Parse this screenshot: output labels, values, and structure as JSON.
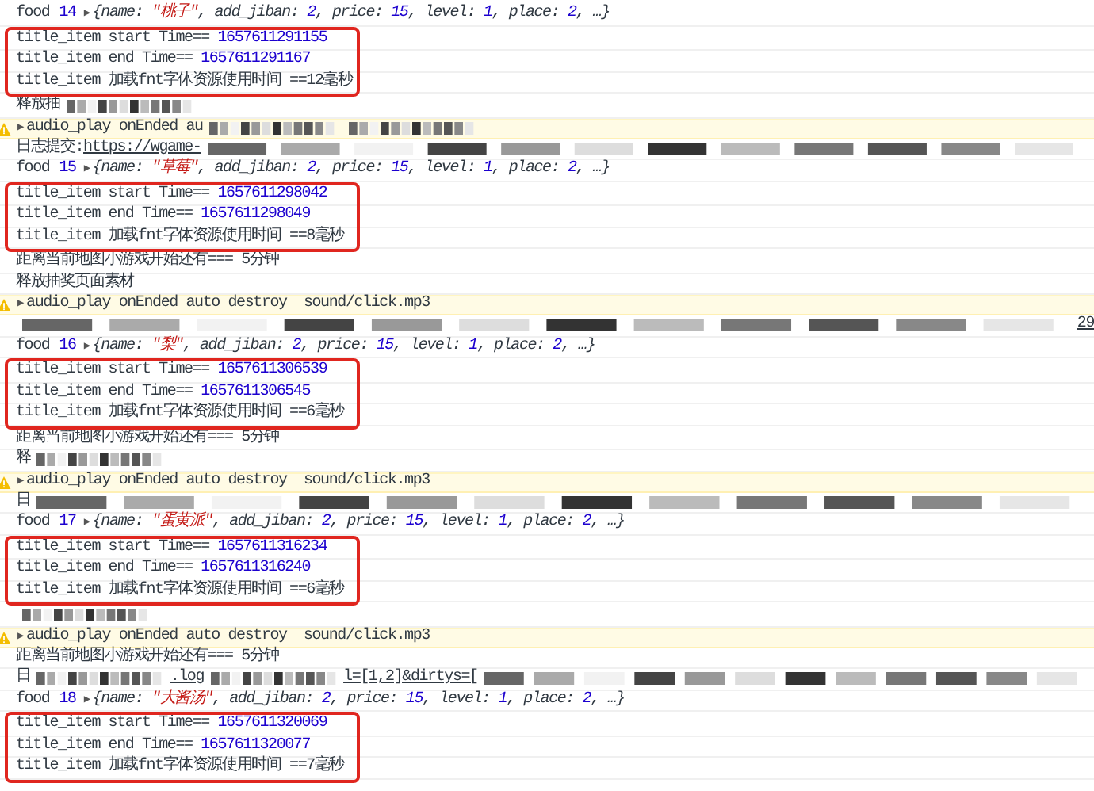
{
  "entries": [
    {
      "kind": "food",
      "label": "food",
      "index": "14",
      "toggle": "▶",
      "segments": [
        {
          "t": "{name: ",
          "kind": "plain"
        },
        {
          "t": "\"桃子\"",
          "kind": "string"
        },
        {
          "t": ", add_jiban: ",
          "kind": "plain"
        },
        {
          "t": "2",
          "kind": "number"
        },
        {
          "t": ", price: ",
          "kind": "plain"
        },
        {
          "t": "15",
          "kind": "number"
        },
        {
          "t": ", level: ",
          "kind": "plain"
        },
        {
          "t": "1",
          "kind": "number"
        },
        {
          "t": ", place: ",
          "kind": "plain"
        },
        {
          "t": "2",
          "kind": "number"
        },
        {
          "t": ", …}",
          "kind": "plain"
        }
      ]
    },
    {
      "kind": "timing",
      "highlighted": true,
      "lines": [
        [
          {
            "t": "title_item start Time== ",
            "kind": "plain"
          },
          {
            "t": "1657611291155",
            "kind": "number"
          }
        ],
        [
          {
            "t": "title_item end Time== ",
            "kind": "plain"
          },
          {
            "t": "1657611291167",
            "kind": "number"
          }
        ],
        [
          {
            "t": "title_item 加载fnt字体资源使用时间 ==12毫秒",
            "kind": "plain"
          }
        ]
      ]
    },
    {
      "kind": "log",
      "segments": [
        {
          "t": "释放抽",
          "kind": "plain"
        },
        {
          "kind": "redacted"
        }
      ]
    },
    {
      "kind": "warn",
      "toggle": "▶",
      "segments": [
        {
          "t": "audio_play onEnded au",
          "kind": "plain"
        },
        {
          "kind": "redacted"
        },
        {
          "kind": "redacted"
        }
      ]
    },
    {
      "kind": "log",
      "segments": [
        {
          "t": "日志提交:",
          "kind": "plain"
        },
        {
          "t": "https://wgame-",
          "kind": "link"
        },
        {
          "kind": "redacted_fill"
        }
      ]
    },
    {
      "kind": "food",
      "label": "food",
      "index": "15",
      "toggle": "▶",
      "segments": [
        {
          "t": "{name: ",
          "kind": "plain"
        },
        {
          "t": "\"草莓\"",
          "kind": "string"
        },
        {
          "t": ", add_jiban: ",
          "kind": "plain"
        },
        {
          "t": "2",
          "kind": "number"
        },
        {
          "t": ", price: ",
          "kind": "plain"
        },
        {
          "t": "15",
          "kind": "number"
        },
        {
          "t": ", level: ",
          "kind": "plain"
        },
        {
          "t": "1",
          "kind": "number"
        },
        {
          "t": ", place: ",
          "kind": "plain"
        },
        {
          "t": "2",
          "kind": "number"
        },
        {
          "t": ", …}",
          "kind": "plain"
        }
      ]
    },
    {
      "kind": "timing",
      "highlighted": true,
      "lines": [
        [
          {
            "t": "title_item start Time== ",
            "kind": "plain"
          },
          {
            "t": "1657611298042",
            "kind": "number"
          }
        ],
        [
          {
            "t": "title_item end Time== ",
            "kind": "plain"
          },
          {
            "t": "1657611298049",
            "kind": "number"
          }
        ],
        [
          {
            "t": "title_item 加载fnt字体资源使用时间 ==8毫秒",
            "kind": "plain"
          }
        ]
      ]
    },
    {
      "kind": "log",
      "segments": [
        {
          "t": "距离当前地图小游戏开始还有=== 5分钟",
          "kind": "plain"
        }
      ]
    },
    {
      "kind": "log",
      "segments": [
        {
          "t": "释放抽奖页面素材",
          "kind": "plain"
        }
      ]
    },
    {
      "kind": "warn",
      "toggle": "▶",
      "segments": [
        {
          "t": "audio_play onEnded auto destroy  sound/click.mp3",
          "kind": "plain"
        }
      ]
    },
    {
      "kind": "log",
      "segments": [
        {
          "kind": "redacted_fill"
        },
        {
          "t": "29",
          "kind": "link"
        }
      ]
    },
    {
      "kind": "food",
      "label": "food",
      "index": "16",
      "toggle": "▶",
      "segments": [
        {
          "t": "{name: ",
          "kind": "plain"
        },
        {
          "t": "\"梨\"",
          "kind": "string"
        },
        {
          "t": ", add_jiban: ",
          "kind": "plain"
        },
        {
          "t": "2",
          "kind": "number"
        },
        {
          "t": ", price: ",
          "kind": "plain"
        },
        {
          "t": "15",
          "kind": "number"
        },
        {
          "t": ", level: ",
          "kind": "plain"
        },
        {
          "t": "1",
          "kind": "number"
        },
        {
          "t": ", place: ",
          "kind": "plain"
        },
        {
          "t": "2",
          "kind": "number"
        },
        {
          "t": ", …}",
          "kind": "plain"
        }
      ]
    },
    {
      "kind": "timing",
      "highlighted": true,
      "lines": [
        [
          {
            "t": "title_item start Time== ",
            "kind": "plain"
          },
          {
            "t": "1657611306539",
            "kind": "number"
          }
        ],
        [
          {
            "t": "title_item end Time== ",
            "kind": "plain"
          },
          {
            "t": "1657611306545",
            "kind": "number"
          }
        ],
        [
          {
            "t": "title_item 加载fnt字体资源使用时间 ==6毫秒",
            "kind": "plain"
          }
        ]
      ]
    },
    {
      "kind": "log",
      "segments": [
        {
          "t": "距离当前地图小游戏开始还有=== 5分钟",
          "kind": "plain"
        }
      ]
    },
    {
      "kind": "log",
      "segments": [
        {
          "t": "释",
          "kind": "plain"
        },
        {
          "kind": "redacted"
        }
      ]
    },
    {
      "kind": "warn",
      "toggle": "▶",
      "segments": [
        {
          "t": "audio_play onEnded auto destroy  sound/click.mp3",
          "kind": "plain"
        }
      ]
    },
    {
      "kind": "log",
      "segments": [
        {
          "t": "日",
          "kind": "plain"
        },
        {
          "kind": "redacted_fill"
        }
      ]
    },
    {
      "kind": "food",
      "label": "food",
      "index": "17",
      "toggle": "▶",
      "segments": [
        {
          "t": "{name: ",
          "kind": "plain"
        },
        {
          "t": "\"蛋黄派\"",
          "kind": "string"
        },
        {
          "t": ", add_jiban: ",
          "kind": "plain"
        },
        {
          "t": "2",
          "kind": "number"
        },
        {
          "t": ", price: ",
          "kind": "plain"
        },
        {
          "t": "15",
          "kind": "number"
        },
        {
          "t": ", level: ",
          "kind": "plain"
        },
        {
          "t": "1",
          "kind": "number"
        },
        {
          "t": ", place: ",
          "kind": "plain"
        },
        {
          "t": "2",
          "kind": "number"
        },
        {
          "t": ", …}",
          "kind": "plain"
        }
      ]
    },
    {
      "kind": "timing",
      "highlighted": true,
      "lines": [
        [
          {
            "t": "title_item start Time== ",
            "kind": "plain"
          },
          {
            "t": "1657611316234",
            "kind": "number"
          }
        ],
        [
          {
            "t": "title_item end Time== ",
            "kind": "plain"
          },
          {
            "t": "1657611316240",
            "kind": "number"
          }
        ],
        [
          {
            "t": "title_item 加载fnt字体资源使用时间 ==6毫秒",
            "kind": "plain"
          }
        ]
      ]
    },
    {
      "kind": "log",
      "segments": [
        {
          "kind": "redacted"
        }
      ]
    },
    {
      "kind": "warn",
      "toggle": "▶",
      "segments": [
        {
          "t": "audio_play onEnded auto destroy  sound/click.mp3",
          "kind": "plain"
        }
      ]
    },
    {
      "kind": "log",
      "segments": [
        {
          "t": "距离当前地图小游戏开始还有=== 5分钟",
          "kind": "plain"
        }
      ]
    },
    {
      "kind": "log",
      "segments": [
        {
          "t": "日",
          "kind": "plain"
        },
        {
          "kind": "redacted"
        },
        {
          "t": ".log",
          "kind": "link"
        },
        {
          "kind": "redacted"
        },
        {
          "t": "l=[1,2]&dirtys=[",
          "kind": "link"
        },
        {
          "kind": "redacted_fill"
        }
      ]
    },
    {
      "kind": "food",
      "label": "food",
      "index": "18",
      "toggle": "▶",
      "segments": [
        {
          "t": "{name: ",
          "kind": "plain"
        },
        {
          "t": "\"大酱汤\"",
          "kind": "string"
        },
        {
          "t": ", add_jiban: ",
          "kind": "plain"
        },
        {
          "t": "2",
          "kind": "number"
        },
        {
          "t": ", price: ",
          "kind": "plain"
        },
        {
          "t": "15",
          "kind": "number"
        },
        {
          "t": ", level: ",
          "kind": "plain"
        },
        {
          "t": "1",
          "kind": "number"
        },
        {
          "t": ", place: ",
          "kind": "plain"
        },
        {
          "t": "2",
          "kind": "number"
        },
        {
          "t": ", …}",
          "kind": "plain"
        }
      ]
    },
    {
      "kind": "timing",
      "highlighted": true,
      "lines": [
        [
          {
            "t": "title_item start Time== ",
            "kind": "plain"
          },
          {
            "t": "1657611320069",
            "kind": "number"
          }
        ],
        [
          {
            "t": "title_item end Time== ",
            "kind": "plain"
          },
          {
            "t": "1657611320077",
            "kind": "number"
          }
        ],
        [
          {
            "t": "title_item 加载fnt字体资源使用时间 ==7毫秒",
            "kind": "plain"
          }
        ]
      ]
    }
  ]
}
